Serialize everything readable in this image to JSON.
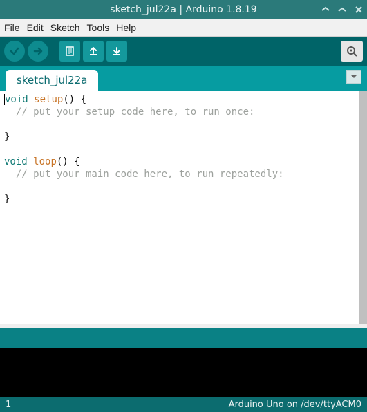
{
  "titlebar": {
    "title": "sketch_jul22a | Arduino 1.8.19"
  },
  "menubar": {
    "file": "File",
    "edit": "Edit",
    "sketch": "Sketch",
    "tools": "Tools",
    "help": "Help"
  },
  "tabs": {
    "active": "sketch_jul22a"
  },
  "code": {
    "lines": [
      {
        "tokens": [
          {
            "t": "void",
            "c": "kw"
          },
          {
            "t": " "
          },
          {
            "t": "setup",
            "c": "fn"
          },
          {
            "t": "() {"
          }
        ]
      },
      {
        "tokens": [
          {
            "t": "  // put your setup code here, to run once:",
            "c": "cm"
          }
        ]
      },
      {
        "tokens": [
          {
            "t": ""
          }
        ]
      },
      {
        "tokens": [
          {
            "t": "}"
          }
        ]
      },
      {
        "tokens": [
          {
            "t": ""
          }
        ]
      },
      {
        "tokens": [
          {
            "t": "void",
            "c": "kw"
          },
          {
            "t": " "
          },
          {
            "t": "loop",
            "c": "fn"
          },
          {
            "t": "() {"
          }
        ]
      },
      {
        "tokens": [
          {
            "t": "  // put your main code here, to run repeatedly:",
            "c": "cm"
          }
        ]
      },
      {
        "tokens": [
          {
            "t": ""
          }
        ]
      },
      {
        "tokens": [
          {
            "t": "}"
          }
        ]
      }
    ]
  },
  "footer": {
    "line_no": "1",
    "board_port": "Arduino Uno on /dev/ttyACM0"
  }
}
